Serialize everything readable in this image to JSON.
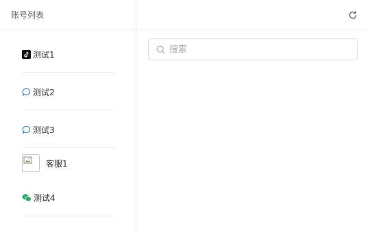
{
  "left_panel": {
    "title": "账号列表",
    "accounts": [
      {
        "name": "测试1",
        "icon": "tiktok-icon"
      },
      {
        "name": "测试2",
        "icon": "chat-bubble-icon"
      },
      {
        "name": "测试3",
        "icon": "chat-bubble-icon"
      },
      {
        "name": "客服1",
        "icon": "broken-avatar-image"
      },
      {
        "name": "测试4",
        "icon": "wechat-icon"
      }
    ]
  },
  "right_panel": {
    "refresh_icon": "refresh-icon",
    "search": {
      "placeholder": "搜索",
      "value": ""
    }
  },
  "colors": {
    "border": "#eeeeee",
    "text": "#303133",
    "muted": "#606266",
    "placeholder": "#a8abb2",
    "chat_blue": "#3b8fd9",
    "wechat_green": "#2aae67"
  }
}
